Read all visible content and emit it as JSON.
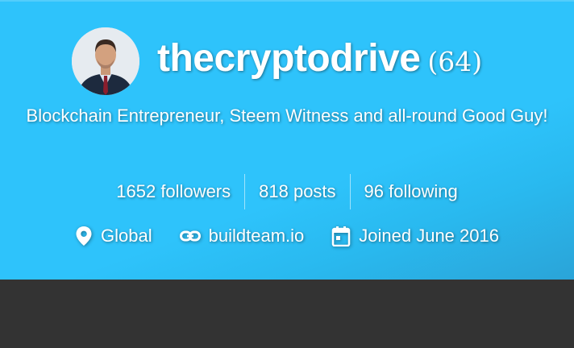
{
  "profile": {
    "username": "thecryptodrive",
    "reputation": "(64)",
    "about": "Blockchain Entrepreneur, Steem Witness and all-round Good Guy!"
  },
  "stats": {
    "followers": "1652 followers",
    "posts": "818 posts",
    "following": "96 following"
  },
  "meta": {
    "location": "Global",
    "website": "buildteam.io",
    "joined": "Joined June 2016"
  },
  "icons": {
    "location": "map-pin-icon",
    "website": "link-icon",
    "joined": "calendar-icon"
  },
  "colors": {
    "banner": "#2ec3fb",
    "text": "#ffffff",
    "lower_background": "#333333"
  }
}
